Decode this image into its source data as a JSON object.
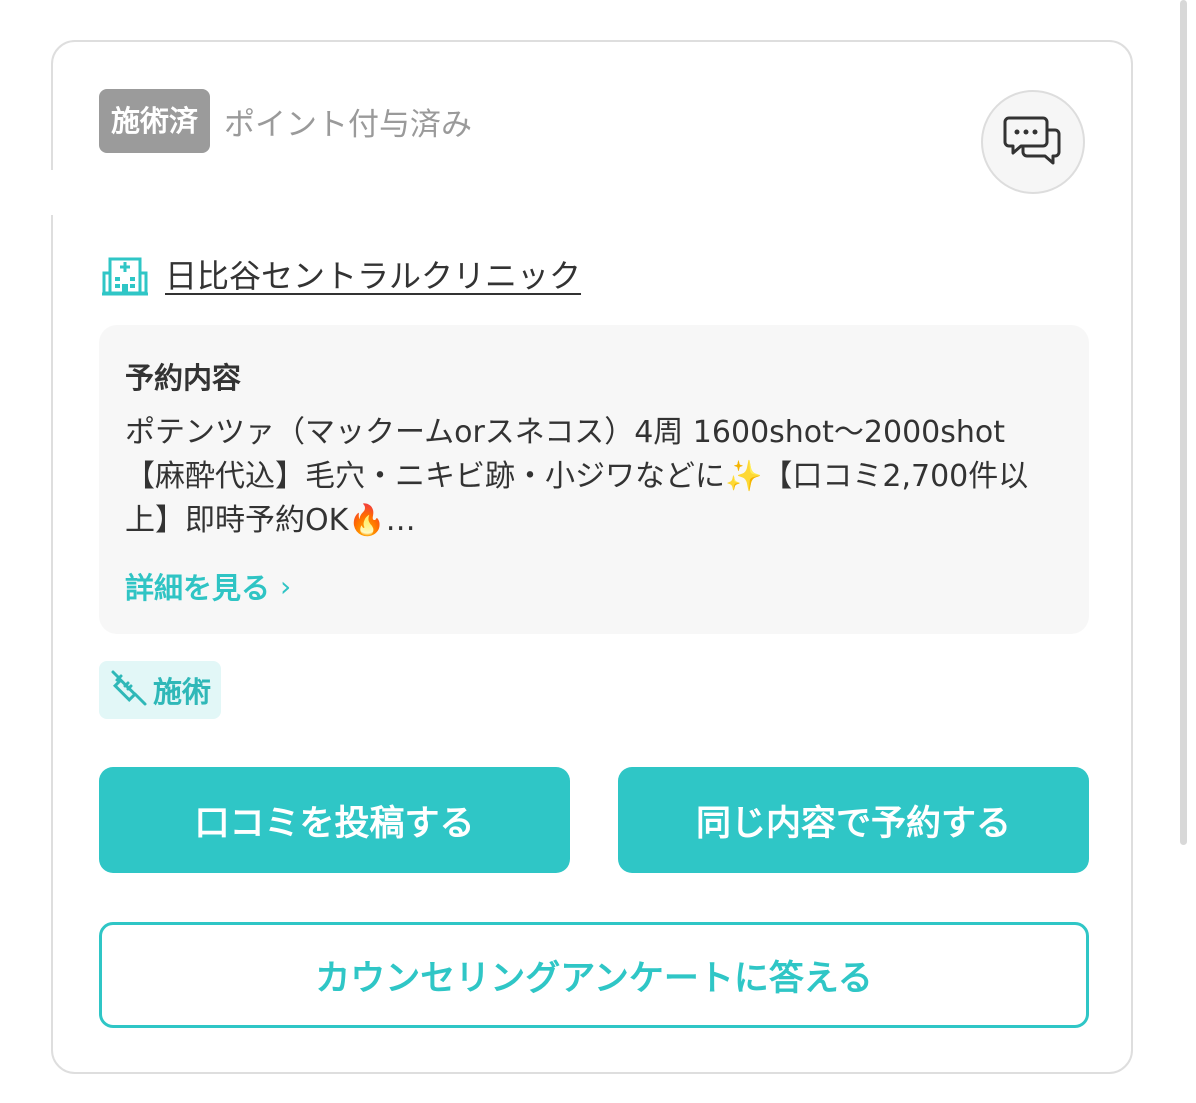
{
  "status": {
    "badge": "施術済",
    "text": "ポイント付与済み"
  },
  "clinic": {
    "name": "日比谷セントラルクリニック",
    "icon": "hospital-icon"
  },
  "reservation": {
    "title": "予約内容",
    "description": "ポテンツァ（マックームorスネコス）4周 1600shot～2000shot【麻酔代込】毛穴・ニキビ跡・小ジワなどに✨【口コミ2,700件以上】即時予約OK🔥…",
    "details_link": "詳細を見る",
    "details_chevron": "›"
  },
  "tag": {
    "label": "施術",
    "icon": "syringe-icon"
  },
  "buttons": {
    "review": "口コミを投稿する",
    "rebook": "同じ内容で予約する",
    "survey": "カウンセリングアンケートに答える"
  },
  "colors": {
    "accent": "#2fc6c6",
    "badge_bg": "#9b9b9b",
    "box_bg": "#f7f7f7",
    "tag_bg": "#e2f7f7"
  }
}
